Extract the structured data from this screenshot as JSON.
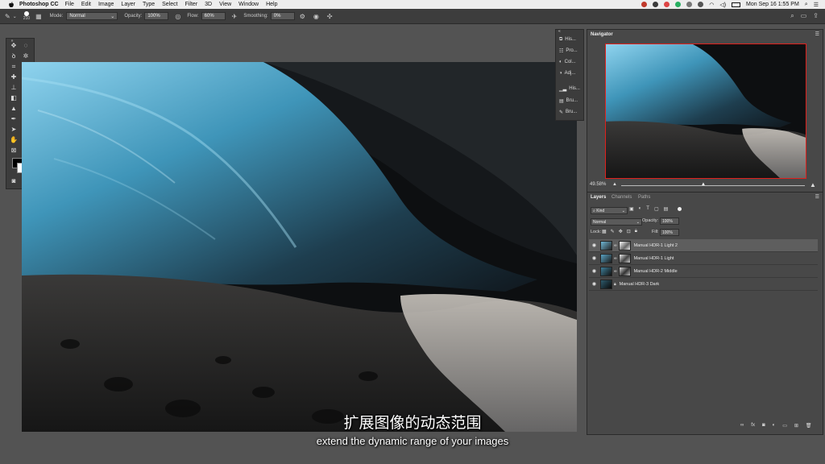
{
  "menubar": {
    "app_name": "Photoshop CC",
    "items": [
      "File",
      "Edit",
      "Image",
      "Layer",
      "Type",
      "Select",
      "Filter",
      "3D",
      "View",
      "Window",
      "Help"
    ],
    "clock": "Mon Sep 16  1:55 PM"
  },
  "options_bar": {
    "brush_size": "210",
    "mode_label": "Mode:",
    "mode_value": "Normal",
    "opacity_label": "Opacity:",
    "opacity_value": "100%",
    "flow_label": "Flow:",
    "flow_value": "60%",
    "smoothing_label": "Smoothing:",
    "smoothing_value": "0%"
  },
  "panel_strip": {
    "items": [
      {
        "label": "His...",
        "icon": "history-icon"
      },
      {
        "label": "Pro...",
        "icon": "properties-icon"
      },
      {
        "label": "Col...",
        "icon": "color-icon"
      },
      {
        "label": "Adj...",
        "icon": "adjustments-icon"
      },
      {
        "label": "His...",
        "icon": "histogram-icon"
      },
      {
        "label": "Bru...",
        "icon": "brush-settings-icon"
      },
      {
        "label": "Bru...",
        "icon": "brushes-icon"
      }
    ]
  },
  "navigator": {
    "title": "Navigator",
    "zoom": "49.58%"
  },
  "layers": {
    "tabs": [
      "Layers",
      "Channels",
      "Paths"
    ],
    "filter_kind": "Kind",
    "blend_mode": "Normal",
    "opacity_label": "Opacity:",
    "opacity_value": "100%",
    "lock_label": "Lock:",
    "fill_label": "Fill:",
    "fill_value": "100%",
    "rows": [
      {
        "name": "Manual HDR-1 Light 2",
        "selected": true
      },
      {
        "name": "Manual HDR-1 Light",
        "selected": false
      },
      {
        "name": "Manual HDR-2 Middle",
        "selected": false
      },
      {
        "name": "Manual HDR-3 Dark",
        "selected": false
      }
    ]
  },
  "subtitles": {
    "chinese": "扩展图像的动态范围",
    "english": "extend the dynamic range of your images"
  },
  "colors": {
    "menubar_bg": "#ededed",
    "panel_bg": "#484848",
    "nav_view_box": "#e0201c"
  }
}
